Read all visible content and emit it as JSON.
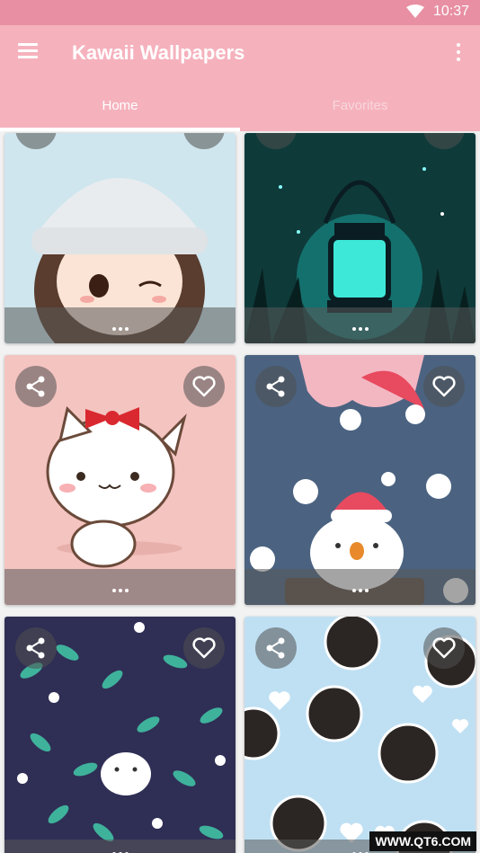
{
  "status": {
    "time": "10:37"
  },
  "app": {
    "title": "Kawaii Wallpapers"
  },
  "tabs": [
    {
      "label": "Home"
    },
    {
      "label": "Favorites"
    }
  ],
  "icons": {
    "menu": "hamburger-icon",
    "overflow": "more-vert-icon",
    "share": "share-icon",
    "favorite": "heart-outline-icon",
    "more": "more-horiz-icon"
  },
  "colors": {
    "statusbar": "#e88fa3",
    "appbar": "#f5b2bd"
  },
  "watermark": "WWW.QT6.COM",
  "wallpapers": [
    {
      "subject": "girl-beanie"
    },
    {
      "subject": "lantern-night"
    },
    {
      "subject": "cat-with-bow"
    },
    {
      "subject": "bird-santa-hat"
    },
    {
      "subject": "leaves-pattern"
    },
    {
      "subject": "cookies-hearts"
    }
  ]
}
